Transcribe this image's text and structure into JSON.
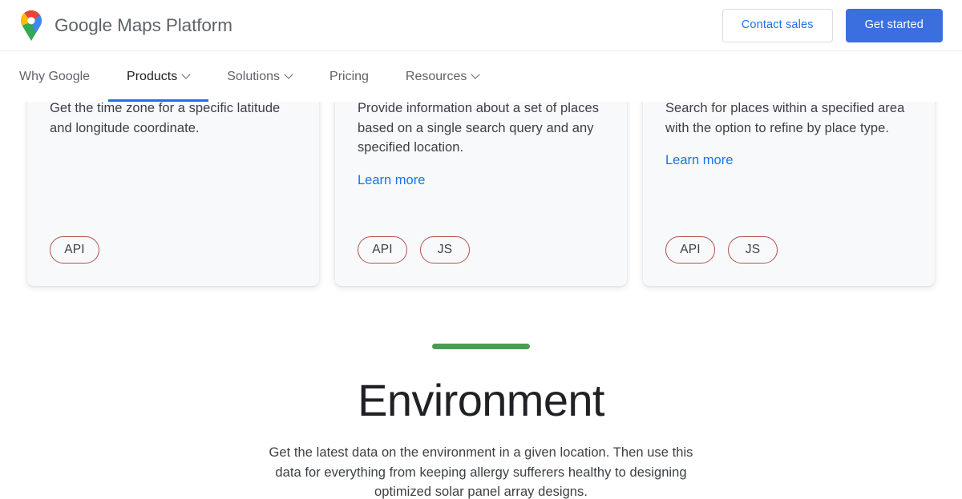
{
  "header": {
    "brand_title": "Google Maps Platform",
    "logo_icon": "google-maps-pin-icon",
    "contact_sales_label": "Contact sales",
    "get_started_label": "Get started",
    "accent_blue": "#1a73e8",
    "button_blue": "#3b6fe0"
  },
  "nav": {
    "items": [
      {
        "label": "Why Google",
        "has_caret": false,
        "active": false
      },
      {
        "label": "Products",
        "has_caret": true,
        "active": true
      },
      {
        "label": "Solutions",
        "has_caret": true,
        "active": false
      },
      {
        "label": "Pricing",
        "has_caret": false,
        "active": false
      },
      {
        "label": "Resources",
        "has_caret": true,
        "active": false
      }
    ]
  },
  "cards": [
    {
      "description": "Get the time zone for a specific latitude and longitude coordinate.",
      "learn_more": "",
      "has_learn_more": false,
      "chips": [
        "API"
      ]
    },
    {
      "description": "Provide information about a set of places based on a single search query and any specified location.",
      "learn_more": "Learn more",
      "has_learn_more": true,
      "chips": [
        "API",
        "JS"
      ]
    },
    {
      "description": "Search for places within a specified area with the option to refine by place type.",
      "learn_more": "Learn more",
      "has_learn_more": true,
      "chips": [
        "API",
        "JS"
      ]
    }
  ],
  "section": {
    "divider_color": "#4e9a52",
    "title": "Environment",
    "subtitle": "Get the latest data on the environment in a given location. Then use this data for everything from keeping allergy sufferers healthy to designing optimized solar panel array designs."
  }
}
